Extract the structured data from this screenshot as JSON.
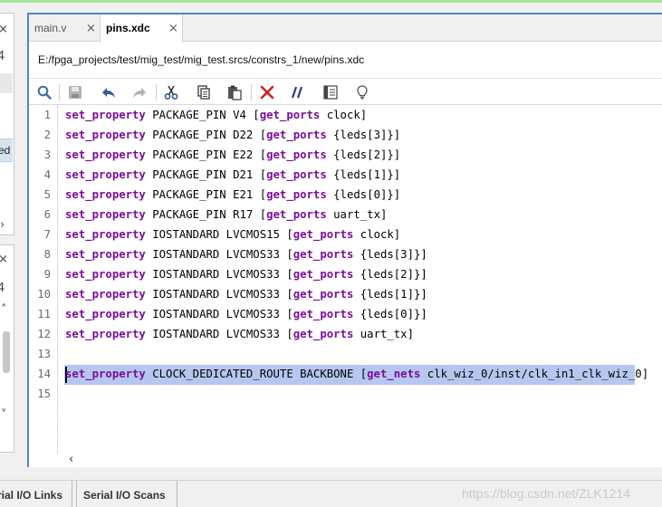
{
  "tabs": [
    {
      "label": "main.v",
      "active": false
    },
    {
      "label": "pins.xdc",
      "active": true
    }
  ],
  "tab_close_glyph": "×",
  "file_path": "E:/fpga_projects/test/mig_test/mig_test.srcs/constrs_1/new/pins.xdc",
  "toolbar": [
    "search-icon",
    "save-icon",
    "undo-icon",
    "redo-icon",
    "cut-icon",
    "copy-icon",
    "paste-icon",
    "delete-icon",
    "comment-icon",
    "block-icon",
    "hint-icon"
  ],
  "left_panel": {
    "glyph_close_1": "×",
    "glyph_4_a": "4",
    "selected_text": "ed",
    "chevron_right": "›",
    "glyph_close_2": "×",
    "glyph_4_b": "4",
    "chevron_up": "˄",
    "chevron_down": "˅"
  },
  "code_lines": [
    {
      "n": "1",
      "kw": "set_property",
      "a": " PACKAGE_PIN V4 [",
      "kw2": "get_ports",
      "b": " clock]"
    },
    {
      "n": "2",
      "kw": "set_property",
      "a": " PACKAGE_PIN D22 [",
      "kw2": "get_ports",
      "b": " {leds[3]}]"
    },
    {
      "n": "3",
      "kw": "set_property",
      "a": " PACKAGE_PIN E22 [",
      "kw2": "get_ports",
      "b": " {leds[2]}]"
    },
    {
      "n": "4",
      "kw": "set_property",
      "a": " PACKAGE_PIN D21 [",
      "kw2": "get_ports",
      "b": " {leds[1]}]"
    },
    {
      "n": "5",
      "kw": "set_property",
      "a": " PACKAGE_PIN E21 [",
      "kw2": "get_ports",
      "b": " {leds[0]}]"
    },
    {
      "n": "6",
      "kw": "set_property",
      "a": " PACKAGE_PIN R17 [",
      "kw2": "get_ports",
      "b": " uart_tx]"
    },
    {
      "n": "7",
      "kw": "set_property",
      "a": " IOSTANDARD LVCMOS15 [",
      "kw2": "get_ports",
      "b": " clock]"
    },
    {
      "n": "8",
      "kw": "set_property",
      "a": " IOSTANDARD LVCMOS33 [",
      "kw2": "get_ports",
      "b": " {leds[3]}]"
    },
    {
      "n": "9",
      "kw": "set_property",
      "a": " IOSTANDARD LVCMOS33 [",
      "kw2": "get_ports",
      "b": " {leds[2]}]"
    },
    {
      "n": "10",
      "kw": "set_property",
      "a": " IOSTANDARD LVCMOS33 [",
      "kw2": "get_ports",
      "b": " {leds[1]}]"
    },
    {
      "n": "11",
      "kw": "set_property",
      "a": " IOSTANDARD LVCMOS33 [",
      "kw2": "get_ports",
      "b": " {leds[0]}]"
    },
    {
      "n": "12",
      "kw": "set_property",
      "a": " IOSTANDARD LVCMOS33 [",
      "kw2": "get_ports",
      "b": " uart_tx]"
    },
    {
      "n": "13",
      "kw": "",
      "a": "",
      "kw2": "",
      "b": ""
    },
    {
      "n": "14",
      "kw": "set_property",
      "a": " CLOCK_DEDICATED_ROUTE BACKBONE [",
      "kw2": "get_nets",
      "b": " clk_wiz_0/inst/clk_in1_clk_wiz_0]",
      "highlighted": true
    },
    {
      "n": "15",
      "kw": "",
      "a": "",
      "kw2": "",
      "b": ""
    }
  ],
  "hscroll_arrow": "‹",
  "bottom_tabs": [
    "rial I/O Links",
    "Serial I/O Scans"
  ],
  "watermark": "https://blog.csdn.net/ZLK1214",
  "colors": {
    "keyword": "#7b0c9e",
    "selection": "#b6c7ef",
    "frame": "#4f86c6"
  }
}
